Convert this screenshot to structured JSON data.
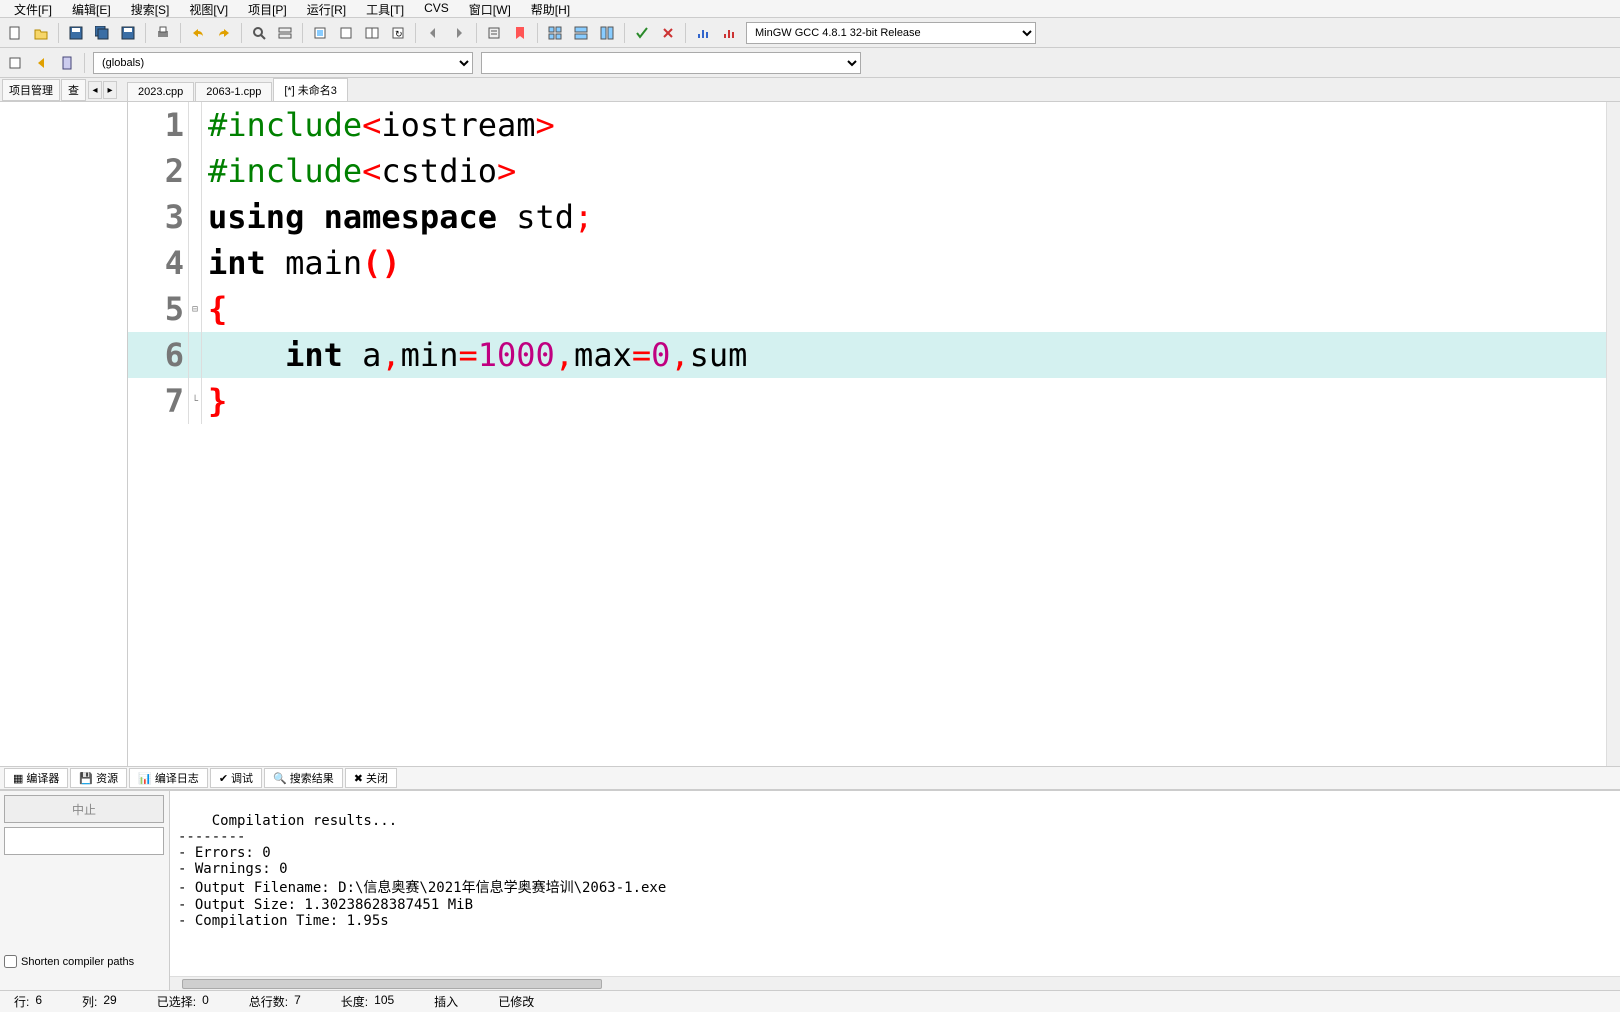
{
  "menu": {
    "items": [
      "文件[F]",
      "编辑[E]",
      "搜索[S]",
      "视图[V]",
      "项目[P]",
      "运行[R]",
      "工具[T]",
      "CVS",
      "窗口[W]",
      "帮助[H]"
    ]
  },
  "toolbar1": {
    "compiler_select": "MinGW GCC 4.8.1 32-bit Release"
  },
  "toolbar2": {
    "scope_select": "(globals)"
  },
  "side_tabs": {
    "t0": "项目管理",
    "t1": "查"
  },
  "file_tabs": [
    {
      "label": "2023.cpp",
      "active": false
    },
    {
      "label": "2063-1.cpp",
      "active": false
    },
    {
      "label": "[*] 未命名3",
      "active": true
    }
  ],
  "code_lines": [
    {
      "n": "1",
      "hl": false,
      "html": "<span class='tok-pre'>#include</span><span class='tok-op'>&lt;</span><span class='tok-id'>iostream</span><span class='tok-op'>&gt;</span>"
    },
    {
      "n": "2",
      "hl": false,
      "html": "<span class='tok-pre'>#include</span><span class='tok-op'>&lt;</span><span class='tok-id'>cstdio</span><span class='tok-op'>&gt;</span>"
    },
    {
      "n": "3",
      "hl": false,
      "html": "<span class='tok-kw'>using</span> <span class='tok-kw'>namespace</span> <span class='tok-id'>std</span><span class='tok-pun'>;</span>"
    },
    {
      "n": "4",
      "hl": false,
      "html": "<span class='tok-type'>int</span> <span class='tok-id'>main</span><span class='tok-brace'>()</span>"
    },
    {
      "n": "5",
      "hl": false,
      "fold": "⊟",
      "html": "<span class='tok-brace'>{</span>"
    },
    {
      "n": "6",
      "hl": true,
      "html": "    <span class='tok-type'>int</span> <span class='tok-id'>a</span><span class='tok-pun'>,</span><span class='tok-id'>min</span><span class='tok-op'>=</span><span class='tok-num'>1000</span><span class='tok-pun'>,</span><span class='tok-id'>max</span><span class='tok-op'>=</span><span class='tok-num'>0</span><span class='tok-pun'>,</span><span class='tok-id'>sum</span>"
    },
    {
      "n": "7",
      "hl": false,
      "fold": "└",
      "html": "<span class='tok-brace'>}</span>"
    }
  ],
  "bottom_tabs": {
    "t0": "编译器",
    "t1": "资源",
    "t2": "编译日志",
    "t3": "调试",
    "t4": "搜索结果",
    "t5": "关闭"
  },
  "compile_left": {
    "stop_btn": "中止",
    "shorten_label": "Shorten compiler paths"
  },
  "compile_output": "Compilation results...\n--------\n- Errors: 0\n- Warnings: 0\n- Output Filename: D:\\信息奥赛\\2021年信息学奥赛培训\\2063-1.exe\n- Output Size: 1.30238628387451 MiB\n- Compilation Time: 1.95s",
  "status": {
    "line_lbl": "行:",
    "line_val": "6",
    "col_lbl": "列:",
    "col_val": "29",
    "sel_lbl": "已选择:",
    "sel_val": "0",
    "total_lines_lbl": "总行数:",
    "total_lines_val": "7",
    "len_lbl": "长度:",
    "len_val": "105",
    "mode": "插入",
    "modified": "已修改"
  }
}
